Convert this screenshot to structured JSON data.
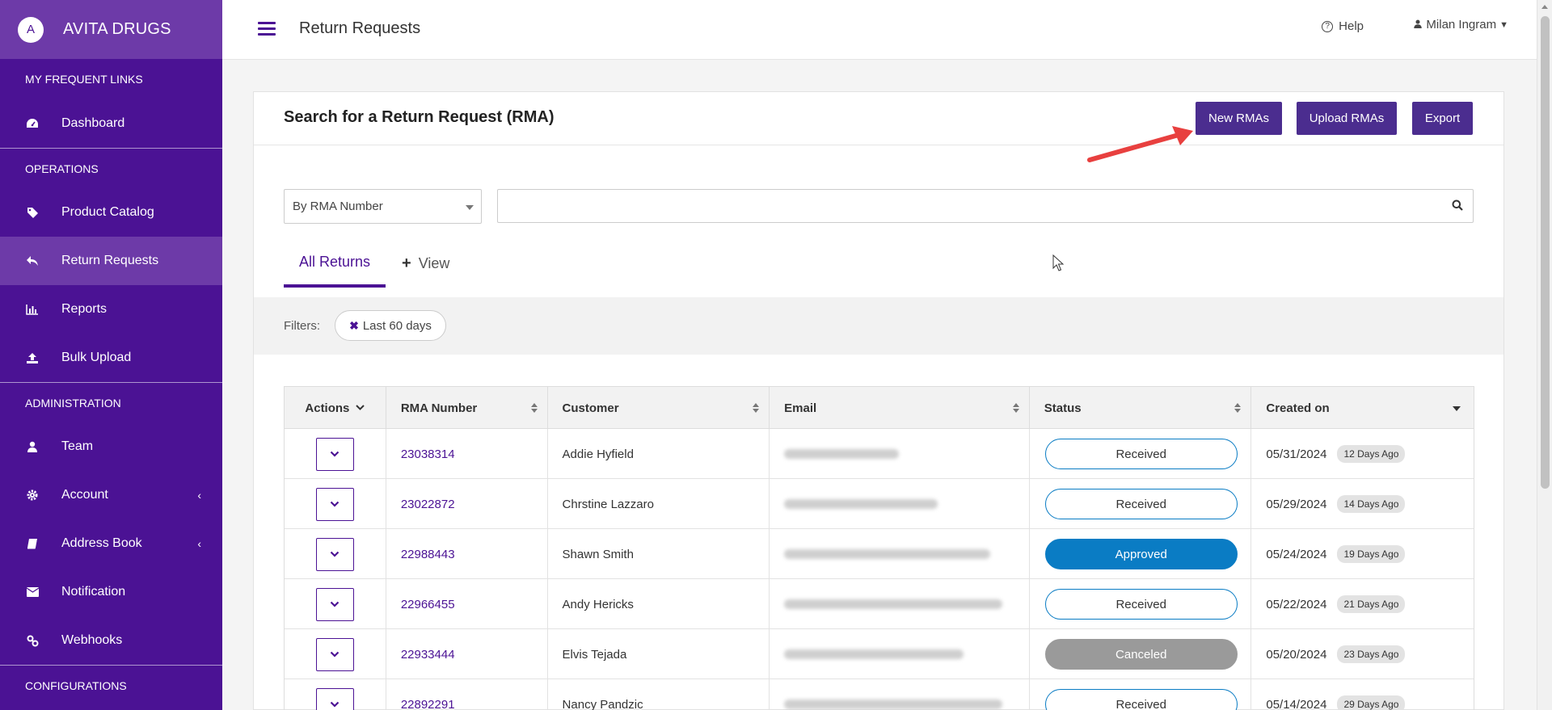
{
  "sidebar": {
    "brand_initial": "A",
    "brand_name": "AVITA DRUGS",
    "section_frequent": "MY FREQUENT LINKS",
    "section_operations": "OPERATIONS",
    "section_administration": "ADMINISTRATION",
    "section_configurations": "CONFIGURATIONS",
    "items": {
      "dashboard": "Dashboard",
      "product_catalog": "Product Catalog",
      "return_requests": "Return Requests",
      "reports": "Reports",
      "bulk_upload": "Bulk Upload",
      "team": "Team",
      "account": "Account",
      "address_book": "Address Book",
      "notification": "Notification",
      "webhooks": "Webhooks"
    },
    "active_item": "return_requests",
    "bg_color": "#4b1294",
    "active_color": "#6d3aa8"
  },
  "topbar": {
    "page_title": "Return Requests",
    "help_label": "Help",
    "user_name": "Milan Ingram"
  },
  "card": {
    "title": "Search for a Return Request (RMA)",
    "buttons": {
      "new": "New RMAs",
      "upload": "Upload RMAs",
      "export": "Export"
    },
    "search": {
      "type_selected": "By RMA Number",
      "query": ""
    },
    "tabs": {
      "all": "All Returns",
      "view": "View"
    },
    "filters": {
      "label": "Filters:",
      "chip": "Last 60 days"
    }
  },
  "table": {
    "headers": {
      "actions": "Actions",
      "rma": "RMA Number",
      "customer": "Customer",
      "email": "Email",
      "status": "Status",
      "created": "Created on"
    },
    "rows": [
      {
        "rma": "23038314",
        "customer": "Addie Hyfield",
        "status": "Received",
        "date": "05/31/2024",
        "ago": "12 Days Ago"
      },
      {
        "rma": "23022872",
        "customer": "Chrstine Lazzaro",
        "status": "Received",
        "date": "05/29/2024",
        "ago": "14 Days Ago"
      },
      {
        "rma": "22988443",
        "customer": "Shawn Smith",
        "status": "Approved",
        "date": "05/24/2024",
        "ago": "19 Days Ago"
      },
      {
        "rma": "22966455",
        "customer": "Andy Hericks",
        "status": "Received",
        "date": "05/22/2024",
        "ago": "21 Days Ago"
      },
      {
        "rma": "22933444",
        "customer": "Elvis Tejada",
        "status": "Canceled",
        "date": "05/20/2024",
        "ago": "23 Days Ago"
      },
      {
        "rma": "22892291",
        "customer": "Nancy Pandzic",
        "status": "Received",
        "date": "05/14/2024",
        "ago": "29 Days Ago"
      }
    ]
  },
  "colors": {
    "primary": "#4b1294",
    "button": "#4b2d8f",
    "status_blue": "#0a7cc4",
    "status_gray": "#9a9a9a",
    "annotation_arrow": "#e8403f"
  }
}
